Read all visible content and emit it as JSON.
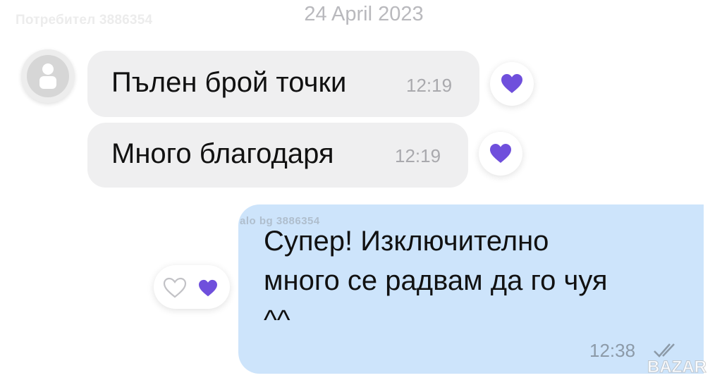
{
  "watermark_user": "Потребител 3886354",
  "date_header": "24 April 2023",
  "messages": [
    {
      "text": "Пълен брой точки",
      "time": "12:19",
      "reaction": "purple-heart"
    },
    {
      "text": "Много благодаря",
      "time": "12:19",
      "reaction": "purple-heart"
    }
  ],
  "outgoing": {
    "lines": [
      "Супер! Изключително",
      "много се радвам да го чуя",
      "^^"
    ],
    "time": "12:38",
    "status": "double-check-read",
    "watermark": "alo bg 3886354"
  },
  "logo_text": "BAZAR",
  "colors": {
    "incoming_bubble": "#efeff0",
    "outgoing_bubble": "#cde4fb",
    "heart": "#6f4fdc"
  }
}
